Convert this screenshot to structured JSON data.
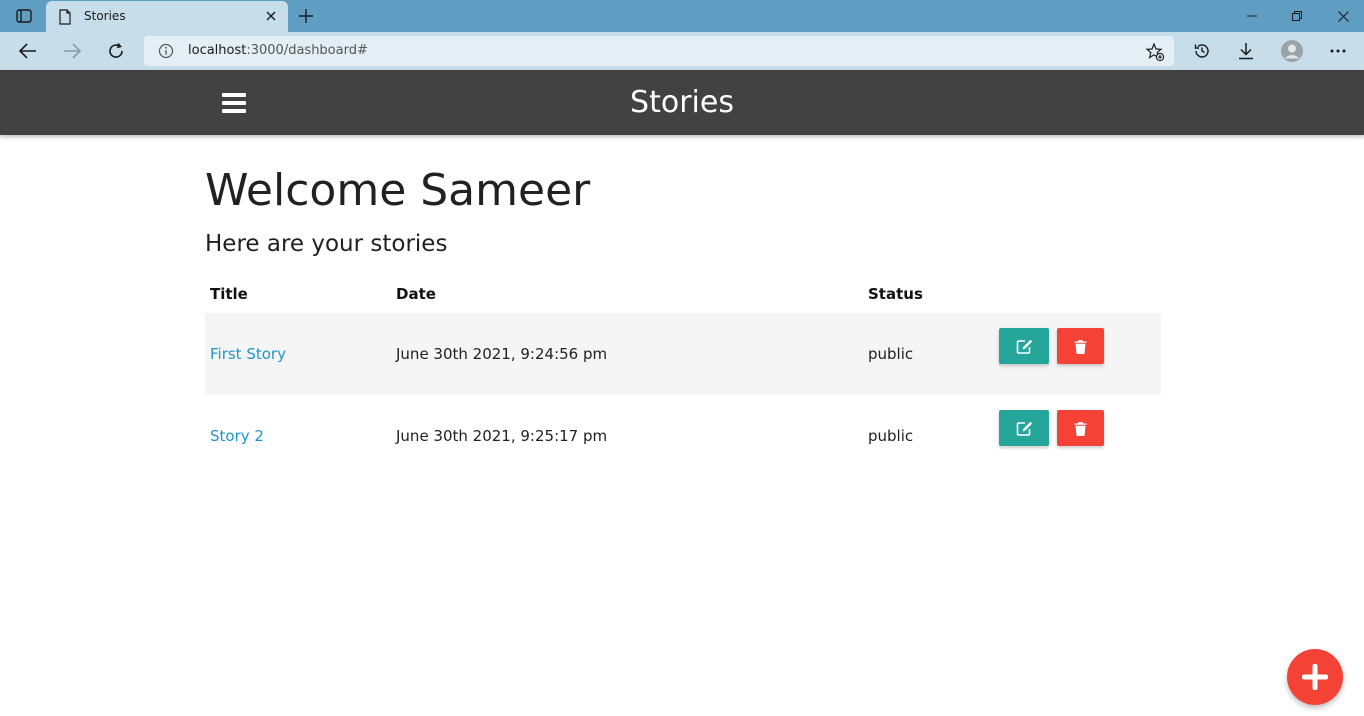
{
  "browser": {
    "tab_title": "Stories",
    "url_host": "localhost",
    "url_rest": ":3000/dashboard#"
  },
  "app": {
    "brand": "Stories",
    "welcome": "Welcome Sameer",
    "subtitle": "Here are your stories"
  },
  "table": {
    "headers": [
      "Title",
      "Date",
      "Status"
    ],
    "rows": [
      {
        "title": "First Story",
        "date": "June 30th 2021, 9:24:56 pm",
        "status": "public"
      },
      {
        "title": "Story 2",
        "date": "June 30th 2021, 9:25:17 pm",
        "status": "public"
      }
    ]
  },
  "colors": {
    "nav_bg": "#424242",
    "edit_button": "#26a69a",
    "delete_button": "#f44336",
    "link": "#2196c4",
    "browser_tabstrip": "#5f9dc3"
  },
  "icons": {
    "menu": "hamburger-icon",
    "edit": "edit-icon",
    "delete": "trash-icon",
    "add": "plus-icon"
  }
}
